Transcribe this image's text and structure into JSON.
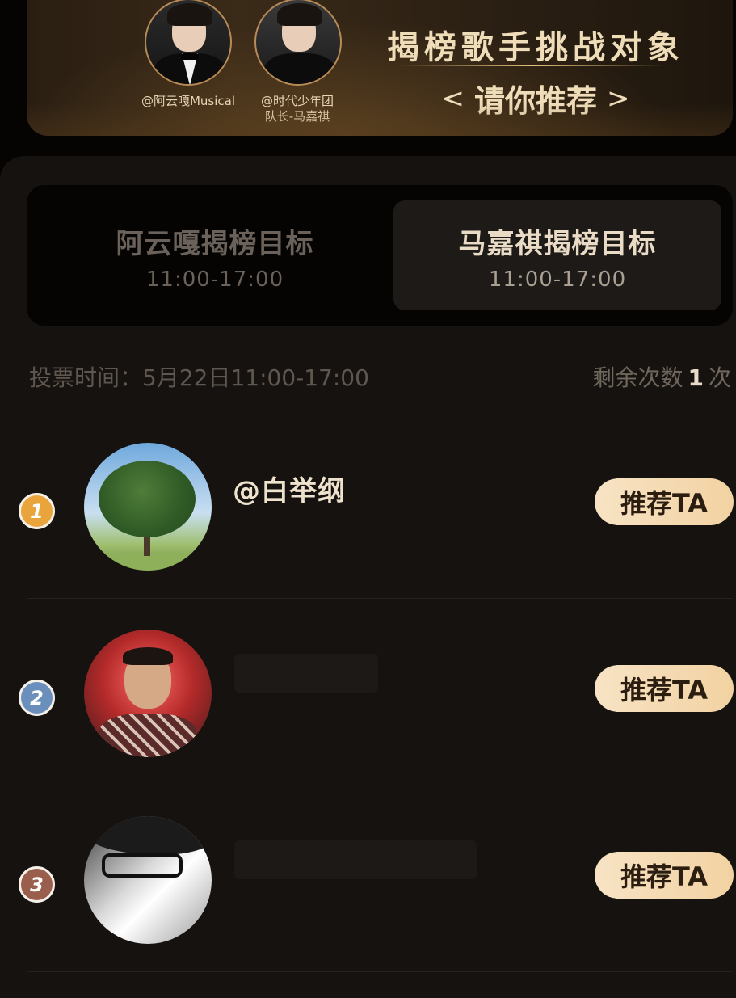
{
  "banner": {
    "title": "揭榜歌手挑战对象",
    "subtitle": "请你推荐",
    "chevron_left": "<",
    "chevron_right": ">",
    "artists": [
      {
        "handle": "@阿云嘎Musical"
      },
      {
        "handle_line1": "@时代少年团",
        "handle_line2": "队长-马嘉祺"
      }
    ]
  },
  "tabs": [
    {
      "label": "阿云嘎揭榜目标",
      "time": "11:00-17:00",
      "selected": false
    },
    {
      "label": "马嘉祺揭榜目标",
      "time": "11:00-17:00",
      "selected": true
    }
  ],
  "vote": {
    "time_label": "投票时间：5月22日11:00-17:00",
    "remaining_prefix": "剩余次数",
    "remaining_count": "1",
    "remaining_suffix": "次"
  },
  "list": [
    {
      "rank": "1",
      "name": "@白举纲",
      "button_label": "推荐TA"
    },
    {
      "rank": "2",
      "name": "",
      "button_label": "推荐TA"
    },
    {
      "rank": "3",
      "name": "",
      "button_label": "推荐TA"
    }
  ],
  "colors": {
    "rank1": "#e9a53c",
    "rank2": "#6b8fbd",
    "rank3": "#9a5e4c",
    "button_gradient_start": "#f7e3c4",
    "button_gradient_end": "#f2d2a2",
    "accent_text": "#efdcb8"
  }
}
